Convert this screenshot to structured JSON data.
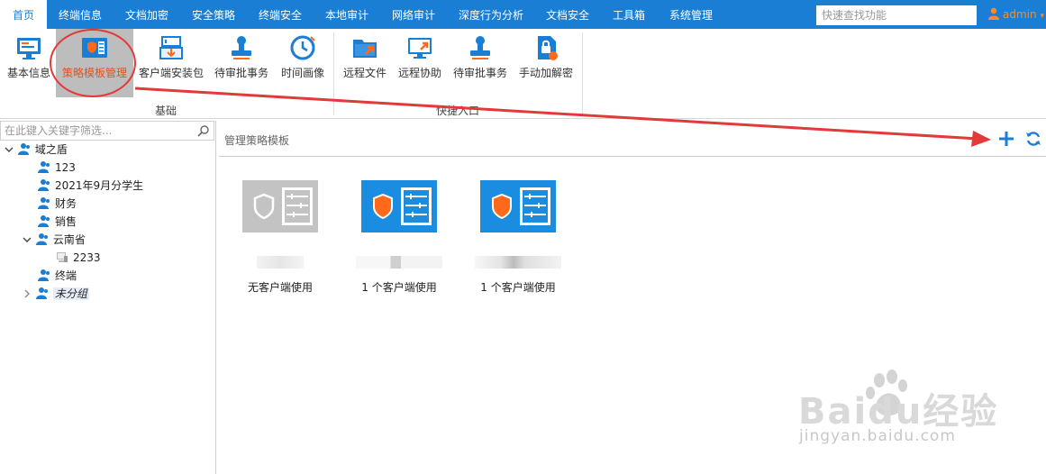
{
  "nav": {
    "tabs": [
      "首页",
      "终端信息",
      "文档加密",
      "安全策略",
      "终端安全",
      "本地审计",
      "网络审计",
      "深度行为分析",
      "文档安全",
      "工具箱",
      "系统管理"
    ],
    "active_tab": "首页",
    "search_placeholder": "快速查找功能",
    "user": "admin"
  },
  "ribbon": {
    "group_basic": {
      "label": "基础",
      "items": [
        "基本信息",
        "策略模板管理",
        "客户端安装包",
        "待审批事务",
        "时间画像"
      ]
    },
    "group_quick": {
      "label": "快捷入口",
      "items": [
        "远程文件",
        "远程协助",
        "待审批事务",
        "手动加解密"
      ]
    },
    "selected_item": "策略模板管理"
  },
  "left": {
    "filter_placeholder": "在此键入关键字筛选...",
    "tree": [
      {
        "label": "域之盾",
        "expanded": true
      },
      {
        "label": "123"
      },
      {
        "label": "2021年9月分学生"
      },
      {
        "label": "财务"
      },
      {
        "label": "销售"
      },
      {
        "label": "云南省",
        "expanded": true
      },
      {
        "label": "2233"
      },
      {
        "label": "终端"
      },
      {
        "label": "未分组",
        "selected": true
      }
    ]
  },
  "right": {
    "title": "管理策略模板",
    "templates": [
      {
        "usage": "无客户端使用",
        "status": "disabled"
      },
      {
        "usage": "1 个客户端使用",
        "status": "active"
      },
      {
        "usage": "1 个客户端使用",
        "status": "active"
      }
    ]
  },
  "colors": {
    "brand": "#1a7fd4",
    "orange": "#ff6a1a",
    "annotation_red": "#e23a3a"
  },
  "watermark": {
    "brand": "Baidu经验",
    "sub": "jingyan.baidu.com"
  }
}
